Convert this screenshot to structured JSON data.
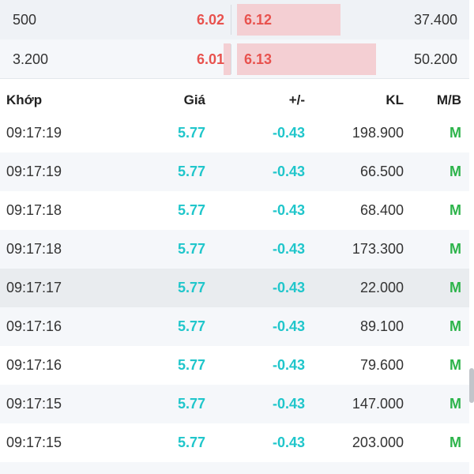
{
  "order_book": [
    {
      "bid_volume": "500",
      "bid_price": "6.02",
      "ask_price": "6.12",
      "ask_volume": "37.400",
      "bid_fill": 0.0,
      "ask_fill": 0.6
    },
    {
      "bid_volume": "3.200",
      "bid_price": "6.01",
      "ask_price": "6.13",
      "ask_volume": "50.200",
      "bid_fill": 0.05,
      "ask_fill": 0.8
    }
  ],
  "trades": {
    "headers": {
      "time": "Khớp",
      "price": "Giá",
      "change": "+/-",
      "volume": "KL",
      "side": "M/B"
    },
    "rows": [
      {
        "time": "09:17:19",
        "price": "5.77",
        "change": "-0.43",
        "volume": "198.900",
        "side": "M"
      },
      {
        "time": "09:17:19",
        "price": "5.77",
        "change": "-0.43",
        "volume": "66.500",
        "side": "M"
      },
      {
        "time": "09:17:18",
        "price": "5.77",
        "change": "-0.43",
        "volume": "68.400",
        "side": "M"
      },
      {
        "time": "09:17:18",
        "price": "5.77",
        "change": "-0.43",
        "volume": "173.300",
        "side": "M"
      },
      {
        "time": "09:17:17",
        "price": "5.77",
        "change": "-0.43",
        "volume": "22.000",
        "side": "M"
      },
      {
        "time": "09:17:16",
        "price": "5.77",
        "change": "-0.43",
        "volume": "89.100",
        "side": "M"
      },
      {
        "time": "09:17:16",
        "price": "5.77",
        "change": "-0.43",
        "volume": "79.600",
        "side": "M"
      },
      {
        "time": "09:17:15",
        "price": "5.77",
        "change": "-0.43",
        "volume": "147.000",
        "side": "M"
      },
      {
        "time": "09:17:15",
        "price": "5.77",
        "change": "-0.43",
        "volume": "203.000",
        "side": "M"
      }
    ]
  },
  "colors": {
    "bid_ask_price": "#e8524e",
    "depth_bar": "#f4cfd3",
    "trade_price": "#20c6cb",
    "buy_side": "#2cb34a"
  }
}
